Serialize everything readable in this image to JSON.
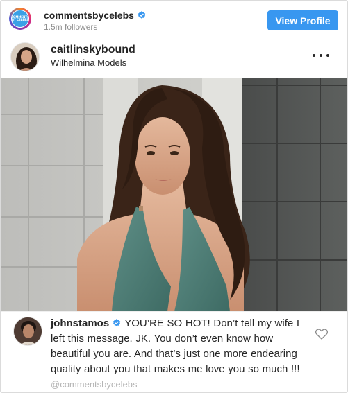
{
  "header": {
    "account_name": "commentsbycelebs",
    "followers": "1.5m followers",
    "avatar_text": "COMMENTS\nBY CELEBS",
    "view_profile_label": "View Profile"
  },
  "post": {
    "author_name": "caitlinskybound",
    "author_location": "Wilhelmina Models",
    "more_icon": "more-horizontal-icon"
  },
  "comment": {
    "commenter": "johnstamos",
    "text": "YOU’RE SO HOT!  Don’t tell my wife I left this message.  JK.  You don’t even know how beautiful you are.  And that’s just one more endearing quality about you that makes me love you so much !!!",
    "watermark": "@commentsbycelebs"
  },
  "colors": {
    "button_blue": "#3897f0",
    "verified_blue": "#3897f0",
    "muted_text": "#8e8e8e",
    "border": "#dbdbdb"
  }
}
